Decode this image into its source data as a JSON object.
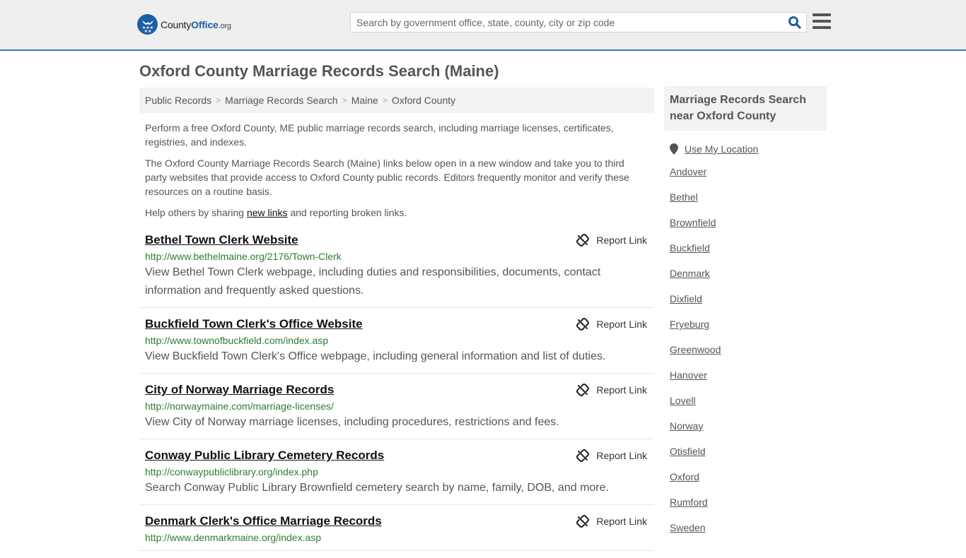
{
  "header": {
    "logo": {
      "name_part1": "County",
      "name_part2": "Office",
      "name_part3": ".org"
    },
    "search": {
      "placeholder": "Search by government office, state, county, city or zip code",
      "value": ""
    },
    "accent_color": "#3a78b0",
    "brand_color": "#1d5fa6"
  },
  "page": {
    "title": "Oxford County Marriage Records Search (Maine)",
    "breadcrumb": [
      "Public Records",
      "Marriage Records Search",
      "Maine",
      "Oxford County"
    ],
    "breadcrumb_sep": ">",
    "intro": {
      "p1": "Perform a free Oxford County, ME public marriage records search, including marriage licenses, certificates, registries, and indexes.",
      "p2": "The Oxford County Marriage Records Search (Maine) links below open in a new window and take you to third party websites that provide access to Oxford County public records. Editors frequently monitor and verify these resources on a routine basis.",
      "p3_before": "Help others by sharing ",
      "p3_link": "new links",
      "p3_after": " and reporting broken links."
    },
    "report_label": "Report Link",
    "results": [
      {
        "title": "Bethel Town Clerk Website",
        "url": "http://www.bethelmaine.org/2176/Town-Clerk",
        "desc": "View Bethel Town Clerk webpage, including duties and responsibilities, documents, contact information and frequently asked questions."
      },
      {
        "title": "Buckfield Town Clerk's Office Website",
        "url": "http://www.townofbuckfield.com/index.asp",
        "desc": "View Buckfield Town Clerk's Office webpage, including general information and list of duties."
      },
      {
        "title": "City of Norway Marriage Records",
        "url": "http://norwaymaine.com/marriage-licenses/",
        "desc": "View City of Norway marriage licenses, including procedures, restrictions and fees."
      },
      {
        "title": "Conway Public Library Cemetery Records",
        "url": "http://conwaypubliclibrary.org/index.php",
        "desc": "Search Conway Public Library Brownfield cemetery search by name, family, DOB, and more."
      },
      {
        "title": "Denmark Clerk's Office Marriage Records",
        "url": "http://www.denmarkmaine.org/index.asp",
        "desc": ""
      }
    ]
  },
  "sidebar": {
    "heading": "Marriage Records Search near Oxford County",
    "use_location": "Use My Location",
    "cities": [
      "Andover",
      "Bethel",
      "Brownfield",
      "Buckfield",
      "Denmark",
      "Dixfield",
      "Fryeburg",
      "Greenwood",
      "Hanover",
      "Lovell",
      "Norway",
      "Otisfield",
      "Oxford",
      "Rumford",
      "Sweden"
    ]
  }
}
